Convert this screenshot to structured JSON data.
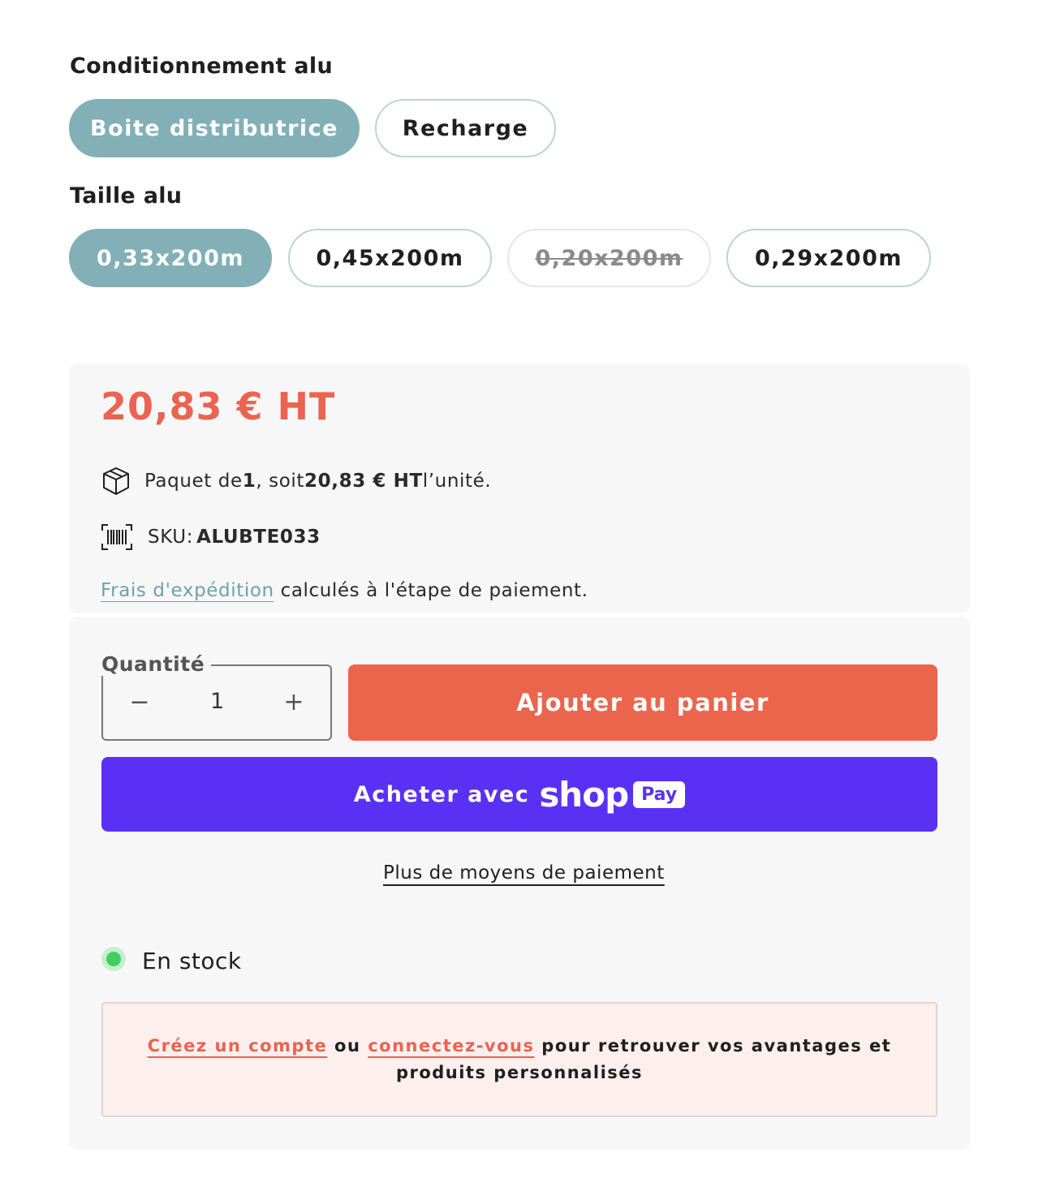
{
  "packaging": {
    "title": "Conditionnement alu",
    "options": [
      {
        "label": "Boite distributrice",
        "state": "selected"
      },
      {
        "label": "Recharge",
        "state": "available"
      }
    ]
  },
  "size": {
    "title": "Taille alu",
    "options": [
      {
        "label": "0,33x200m",
        "state": "selected"
      },
      {
        "label": "0,45x200m",
        "state": "available"
      },
      {
        "label": "0,20x200m",
        "state": "unavailable"
      },
      {
        "label": "0,29x200m",
        "state": "available"
      }
    ]
  },
  "price": {
    "amount": "20,83 € HT",
    "package_prefix": "Paquet de ",
    "package_count": "1",
    "package_mid": ", soit ",
    "unit_price": "20,83 € HT",
    "package_suffix": " l’unité.",
    "sku_label": "SKU: ",
    "sku_value": "ALUBTE033",
    "shipping_link": "Frais d'expédition",
    "shipping_text": " calculés à l'étape de paiement."
  },
  "purchase": {
    "quantity_label": "Quantité",
    "quantity_value": "1",
    "minus": "−",
    "plus": "+",
    "add_to_cart": "Ajouter au panier",
    "shop_pay_prefix": "Acheter avec",
    "shop_logo": "shop",
    "pay_badge": "Pay",
    "more_payment": "Plus de moyens de paiement",
    "stock_status": "En stock"
  },
  "account_prompt": {
    "create_link": "Créez un compte",
    "or": " ou ",
    "login_link": "connectez-vous",
    "rest": " pour retrouver vos avantages et produits personnalisés"
  },
  "colors": {
    "accent_teal": "#82b0b6",
    "price_red": "#ea6450",
    "add_button": "#ea654c",
    "shop_pay_purple": "#5a31f4",
    "stock_green": "#3fcf5e"
  }
}
